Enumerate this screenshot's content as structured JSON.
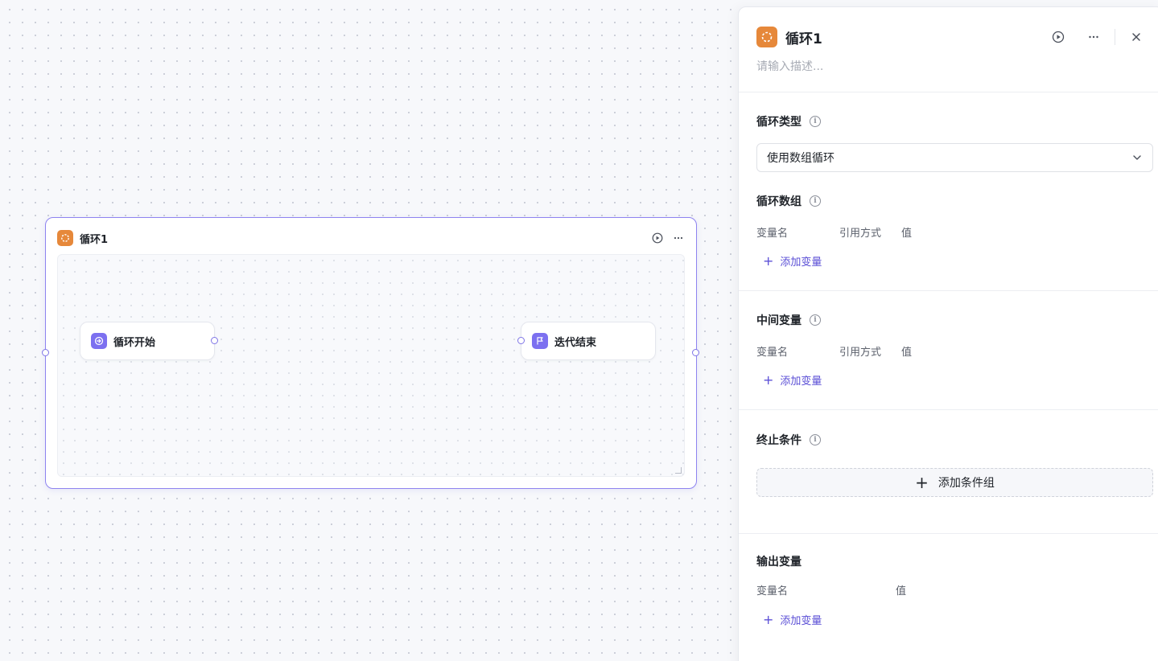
{
  "canvas": {
    "loop_node": {
      "title": "循环1",
      "icon": "loop-icon",
      "children": [
        {
          "label": "循环开始",
          "icon": "enter-icon"
        },
        {
          "label": "迭代结束",
          "icon": "flag-icon"
        }
      ]
    }
  },
  "panel": {
    "title": "循环1",
    "description_placeholder": "请输入描述...",
    "loop_type": {
      "label": "循环类型",
      "value": "使用数组循环"
    },
    "loop_array": {
      "label": "循环数组",
      "columns": [
        "变量名",
        "引用方式",
        "值"
      ],
      "add_label": "添加变量"
    },
    "intermediate": {
      "label": "中间变量",
      "columns": [
        "变量名",
        "引用方式",
        "值"
      ],
      "add_label": "添加变量"
    },
    "termination": {
      "label": "终止条件",
      "add_group_label": "添加条件组"
    },
    "output": {
      "label": "输出变量",
      "columns": [
        "变量名",
        "值"
      ],
      "add_label": "添加变量"
    }
  },
  "colors": {
    "accent": "#5b4fd6",
    "node_orange": "#e6883a",
    "node_purple": "#7c70f0",
    "selected_border": "#8e83f0"
  }
}
